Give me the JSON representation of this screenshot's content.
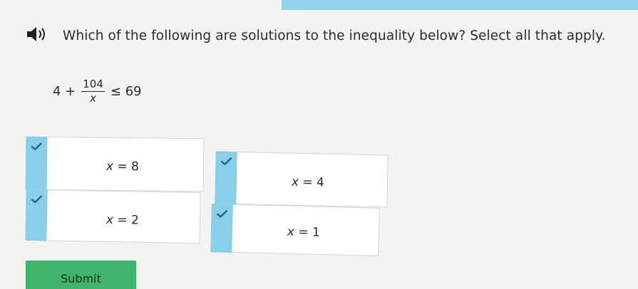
{
  "question": {
    "text": "Which of the following are solutions to the inequality below? Select all that apply.",
    "expression": {
      "left": "4 +",
      "numerator": "104",
      "denominator": "x",
      "right": "≤ 69"
    }
  },
  "choices": [
    {
      "var": "x",
      "rel": "= 8",
      "checked": true
    },
    {
      "var": "x",
      "rel": "= 4",
      "checked": true
    },
    {
      "var": "x",
      "rel": "= 2",
      "checked": true
    },
    {
      "var": "x",
      "rel": "= 1",
      "checked": true
    }
  ],
  "submit_label": "Submit",
  "colors": {
    "accent": "#89cfe9",
    "submit": "#3fb56b"
  },
  "icons": {
    "audio": "speaker-icon",
    "check": "checkmark-icon"
  }
}
